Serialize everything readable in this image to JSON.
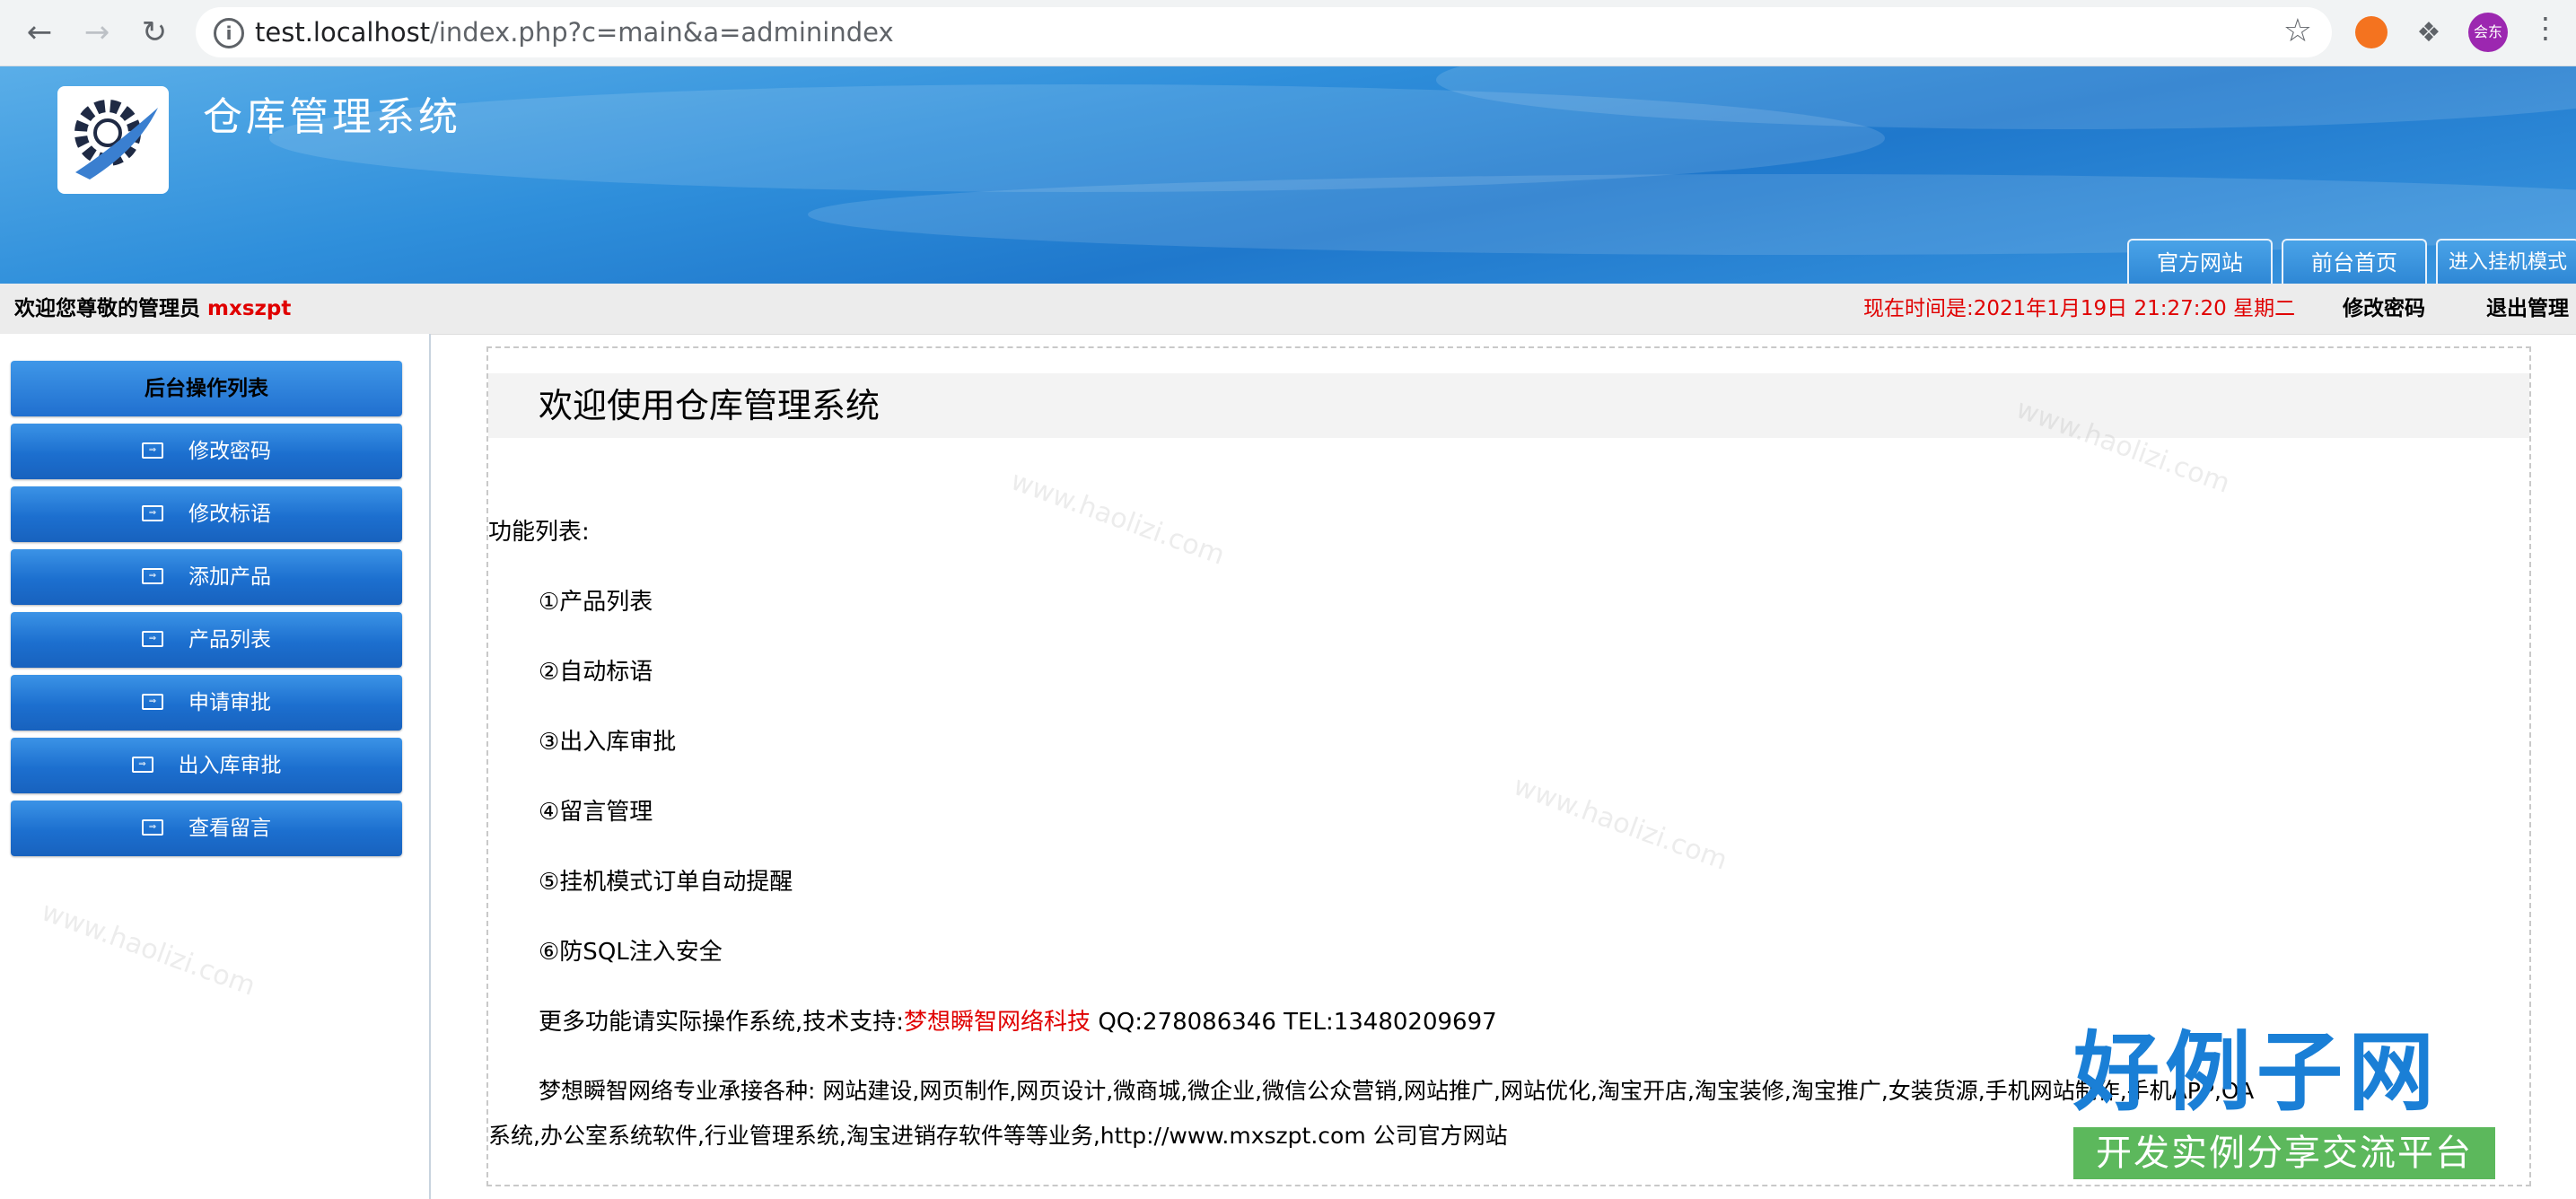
{
  "browser": {
    "url_host": "test.localhost",
    "url_rest": "/index.php?c=main&a=adminindex",
    "avatar_label": "会东"
  },
  "header": {
    "title": "仓库管理系统",
    "buttons": [
      "官方网站",
      "前台首页",
      "进入挂机模式"
    ]
  },
  "infobar": {
    "welcome_prefix": "欢迎您尊敬的管理员",
    "username": "mxszpt",
    "current_time": "现在时间是:2021年1月19日 21:27:20 星期二",
    "change_password": "修改密码",
    "logout": "退出管理"
  },
  "sidebar": {
    "header": "后台操作列表",
    "items": [
      "修改密码",
      "修改标语",
      "添加产品",
      "产品列表",
      "申请审批",
      "出入库审批",
      "查看留言"
    ]
  },
  "main": {
    "title": "欢迎使用仓库管理系统",
    "features_label": "功能列表:",
    "features": [
      "①产品列表",
      "②自动标语",
      "③出入库审批",
      "④留言管理",
      "⑤挂机模式订单自动提醒",
      "⑥防SQL注入安全"
    ],
    "support_prefix": "更多功能请实际操作系统,技术支持:",
    "support_company": "梦想瞬智网络科技",
    "support_contact": "QQ:278086346 TEL:13480209697",
    "promo_line1": "梦想瞬智网络专业承接各种: 网站建设,网页制作,网页设计,微商城,微企业,微信公众营销,网站推广,网站优化,淘宝开店,淘宝装修,淘宝推广,女装货源,手机网站制作,手机APP,OA",
    "promo_line2": "系统,办公室系统软件,行业管理系统,淘宝进销存软件等等业务,http://www.mxszpt.com 公司官方网站"
  },
  "watermark": {
    "text": "www.haolizi.com",
    "brand_big": "好例子网",
    "brand_small": "开发实例分享交流平台"
  }
}
